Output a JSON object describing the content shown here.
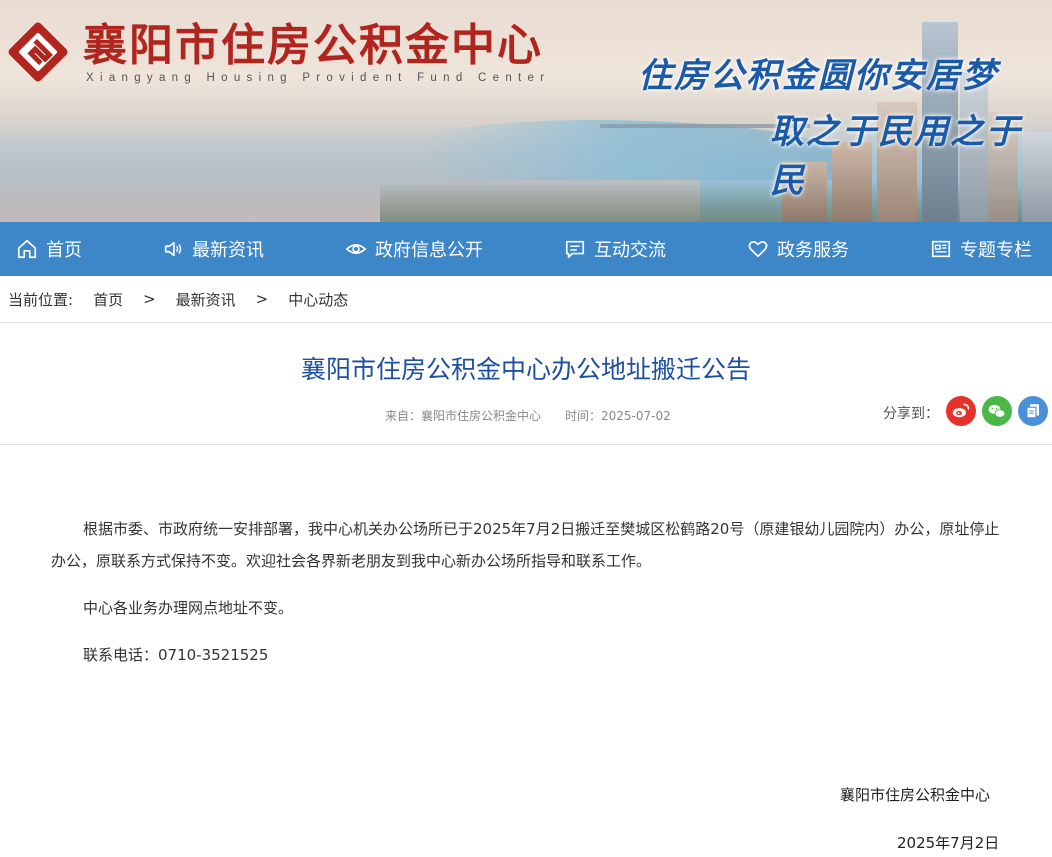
{
  "header": {
    "title": "襄阳市住房公积金中心",
    "subtitle": "Xiangyang Housing Provident Fund Center",
    "slogan_line1": "住房公积金圆你安居梦",
    "slogan_line2": "取之于民用之于民"
  },
  "nav": {
    "items": [
      {
        "label": "首页",
        "icon": "home-icon"
      },
      {
        "label": "最新资讯",
        "icon": "speaker-icon"
      },
      {
        "label": "政府信息公开",
        "icon": "eye-icon"
      },
      {
        "label": "互动交流",
        "icon": "chat-icon"
      },
      {
        "label": "政务服务",
        "icon": "heart-icon"
      },
      {
        "label": "专题专栏",
        "icon": "newspaper-icon"
      }
    ]
  },
  "breadcrumb": {
    "label": "当前位置:",
    "items": [
      "首页",
      "最新资讯",
      "中心动态"
    ],
    "separator": ">"
  },
  "article": {
    "title": "襄阳市住房公积金中心办公地址搬迁公告",
    "source": "来自：襄阳市住房公积金中心",
    "time": "时间：2025-07-02",
    "share_label": "分享到：",
    "paragraphs": [
      "根据市委、市政府统一安排部署，我中心机关办公场所已于2025年7月2日搬迁至樊城区松鹤路20号（原建银幼儿园院内）办公，原址停止办公，原联系方式保持不变。欢迎社会各界新老朋友到我中心新办公场所指导和联系工作。",
      "中心各业务办理网点地址不变。",
      "联系电话：0710-3521525"
    ],
    "signature": "襄阳市住房公积金中心",
    "date": "2025年7月2日"
  },
  "colors": {
    "nav_bg": "#3d86c8",
    "title_red": "#b0261f",
    "article_title": "#1f4fa0",
    "weibo": "#e6332a",
    "wechat": "#4cb749",
    "copy": "#4a90d9"
  }
}
